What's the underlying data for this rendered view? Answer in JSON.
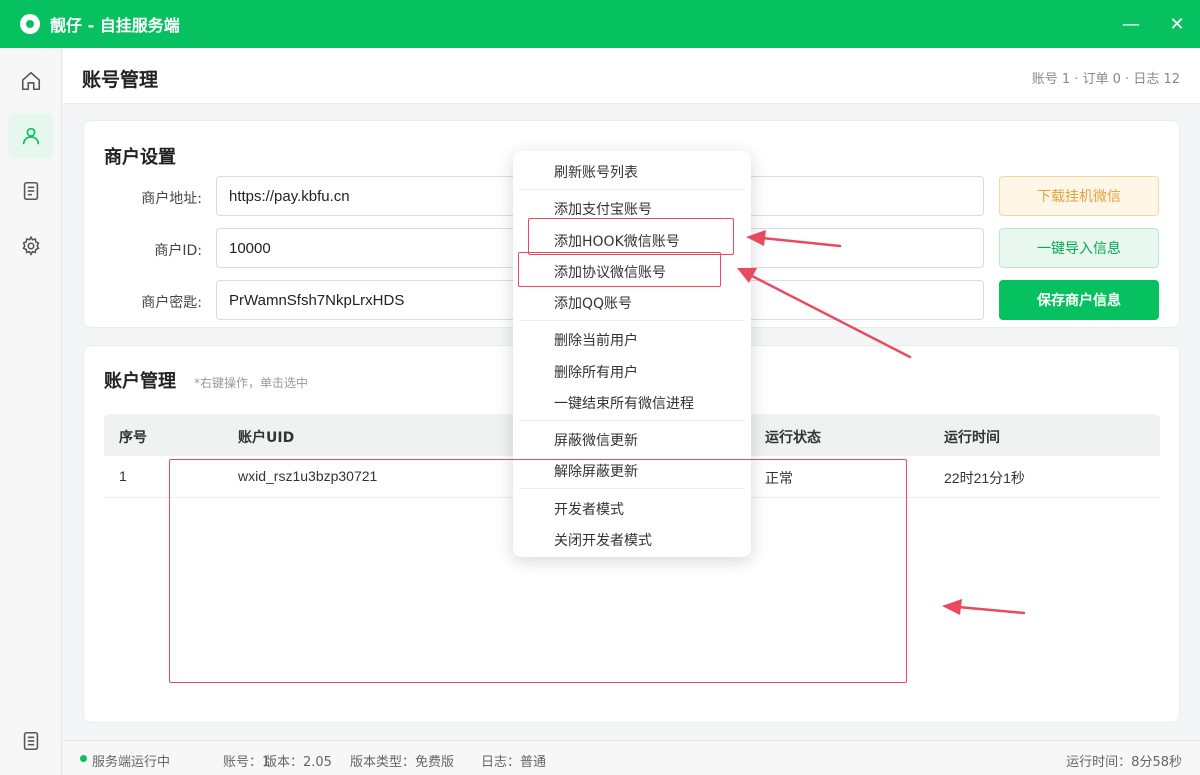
{
  "window": {
    "title": "靓仔 - 自挂服务端",
    "minimize": "—",
    "close": "✕"
  },
  "sidebar": {
    "items": [
      {
        "icon": "home-icon"
      },
      {
        "icon": "user-icon",
        "active": true
      },
      {
        "icon": "document-icon"
      },
      {
        "icon": "gear-icon"
      },
      {
        "icon": "log-icon"
      }
    ]
  },
  "header": {
    "title": "账号管理",
    "stats": "账号 1 · 订单 0 · 日志 12"
  },
  "merchant": {
    "title": "商户设置",
    "address_label": "商户地址:",
    "address_value": "https://pay.kbfu.cn",
    "id_label": "商户ID:",
    "id_value": "10000",
    "key_label": "商户密匙:",
    "key_value": "PrWamnSfsh7NkpLrxHDS",
    "download_button": "下载挂机微信",
    "import_button": "一键导入信息",
    "save_button": "保存商户信息"
  },
  "accounts": {
    "title": "账户管理",
    "hint": "*右键操作，单击选中",
    "columns": [
      "序号",
      "账户UID",
      "运行状态",
      "运行时间"
    ],
    "rows": [
      {
        "index": "1",
        "uid": "wxid_rsz1u3bzp30721",
        "status": "正常",
        "runtime": "22时21分1秒"
      }
    ]
  },
  "context_menu": {
    "items": [
      "刷新账号列表",
      "添加支付宝账号",
      "添加HOOK微信账号",
      "添加协议微信账号",
      "添加QQ账号",
      "删除当前用户",
      "删除所有用户",
      "一键结束所有微信进程",
      "屏蔽微信更新",
      "解除屏蔽更新",
      "开发者模式",
      "关闭开发者模式"
    ]
  },
  "statusbar": {
    "state": "服务端运行中",
    "accounts": "账号：1",
    "version": "版本：2.05",
    "version_type": "版本类型：免费版",
    "log": "日志：普通",
    "uptime": "运行时间：8分58秒"
  },
  "colors": {
    "brand": "#07c160",
    "annotation": "#e84a5f"
  }
}
